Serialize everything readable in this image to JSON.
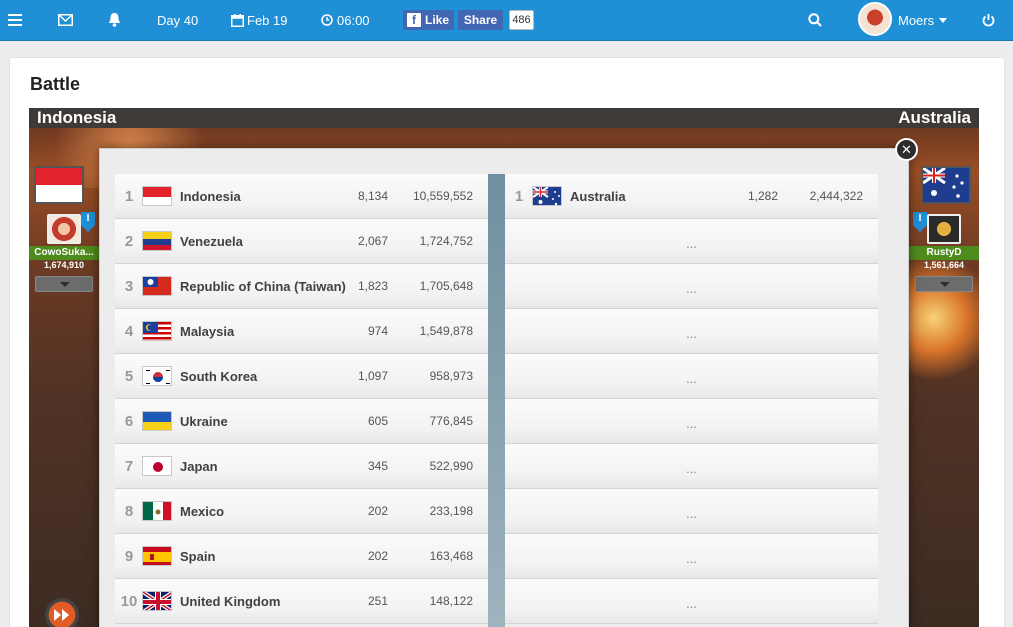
{
  "topbar": {
    "day": "Day 40",
    "date": "Feb 19",
    "time": "06:00",
    "fb_like": "Like",
    "fb_share": "Share",
    "fb_count": "486",
    "user": "Moers"
  },
  "page": {
    "title": "Battle"
  },
  "battle": {
    "left_side": "Indonesia",
    "right_side": "Australia",
    "left_player": {
      "name": "CowoSuka...",
      "damage": "1,674,910"
    },
    "right_player": {
      "name": "RustyD",
      "damage": "1,561,664"
    }
  },
  "colors": {
    "topbar": "#1f8fd6",
    "player_name_bg": "#4e8b1d",
    "fb": "#4267b2"
  },
  "ranking_left": [
    {
      "rank": "1",
      "country": "Indonesia",
      "fighters": "8,134",
      "damage": "10,559,552",
      "flag": "indonesia-flag"
    },
    {
      "rank": "2",
      "country": "Venezuela",
      "fighters": "2,067",
      "damage": "1,724,752",
      "flag": "venezuela-flag"
    },
    {
      "rank": "3",
      "country": "Republic of China (Taiwan)",
      "fighters": "1,823",
      "damage": "1,705,648",
      "flag": "taiwan-flag"
    },
    {
      "rank": "4",
      "country": "Malaysia",
      "fighters": "974",
      "damage": "1,549,878",
      "flag": "malaysia-flag"
    },
    {
      "rank": "5",
      "country": "South Korea",
      "fighters": "1,097",
      "damage": "958,973",
      "flag": "south-korea-flag"
    },
    {
      "rank": "6",
      "country": "Ukraine",
      "fighters": "605",
      "damage": "776,845",
      "flag": "ukraine-flag"
    },
    {
      "rank": "7",
      "country": "Japan",
      "fighters": "345",
      "damage": "522,990",
      "flag": "japan-flag"
    },
    {
      "rank": "8",
      "country": "Mexico",
      "fighters": "202",
      "damage": "233,198",
      "flag": "mexico-flag"
    },
    {
      "rank": "9",
      "country": "Spain",
      "fighters": "202",
      "damage": "163,468",
      "flag": "spain-flag"
    },
    {
      "rank": "10",
      "country": "United Kingdom",
      "fighters": "251",
      "damage": "148,122",
      "flag": "uk-flag"
    }
  ],
  "ranking_right": [
    {
      "rank": "1",
      "country": "Australia",
      "fighters": "1,282",
      "damage": "2,444,322",
      "flag": "australia-flag"
    }
  ],
  "placeholder": "..."
}
